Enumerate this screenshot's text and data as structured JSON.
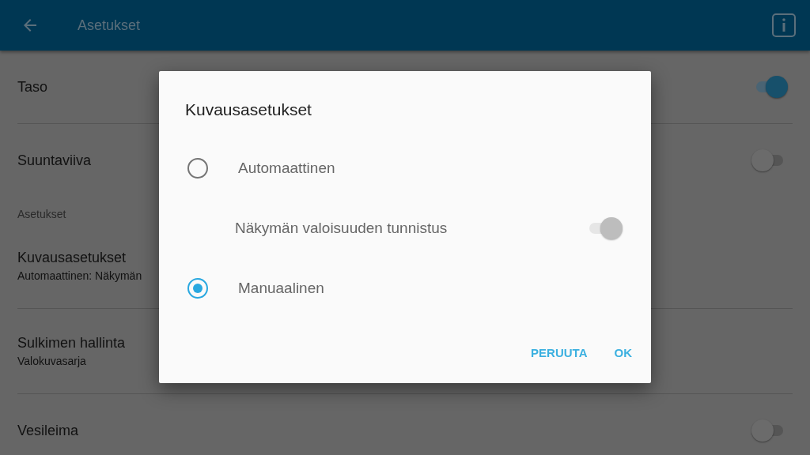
{
  "app_bar": {
    "title": "Asetukset"
  },
  "settings": [
    {
      "kind": "toggle",
      "label": "Taso",
      "on": true
    },
    {
      "kind": "toggle",
      "label": "Suuntaviiva",
      "on": false
    },
    {
      "kind": "subheader",
      "label": "Asetukset"
    },
    {
      "kind": "two-line",
      "label": "Kuvausasetukset",
      "summary": "Automaattinen: Näkymän"
    },
    {
      "kind": "two-line",
      "label": "Sulkimen hallinta",
      "summary": "Valokuvasarja"
    },
    {
      "kind": "toggle",
      "label": "Vesileima",
      "on": false
    }
  ],
  "dialog": {
    "title": "Kuvausasetukset",
    "options": [
      {
        "kind": "radio",
        "label": "Automaattinen",
        "selected": false
      },
      {
        "kind": "switch",
        "label": "Näkymän valoisuuden tunnistus",
        "on": true,
        "disabled": true
      },
      {
        "kind": "radio",
        "label": "Manuaalinen",
        "selected": true
      }
    ],
    "buttons": [
      "PERUUTA",
      "OK"
    ]
  }
}
